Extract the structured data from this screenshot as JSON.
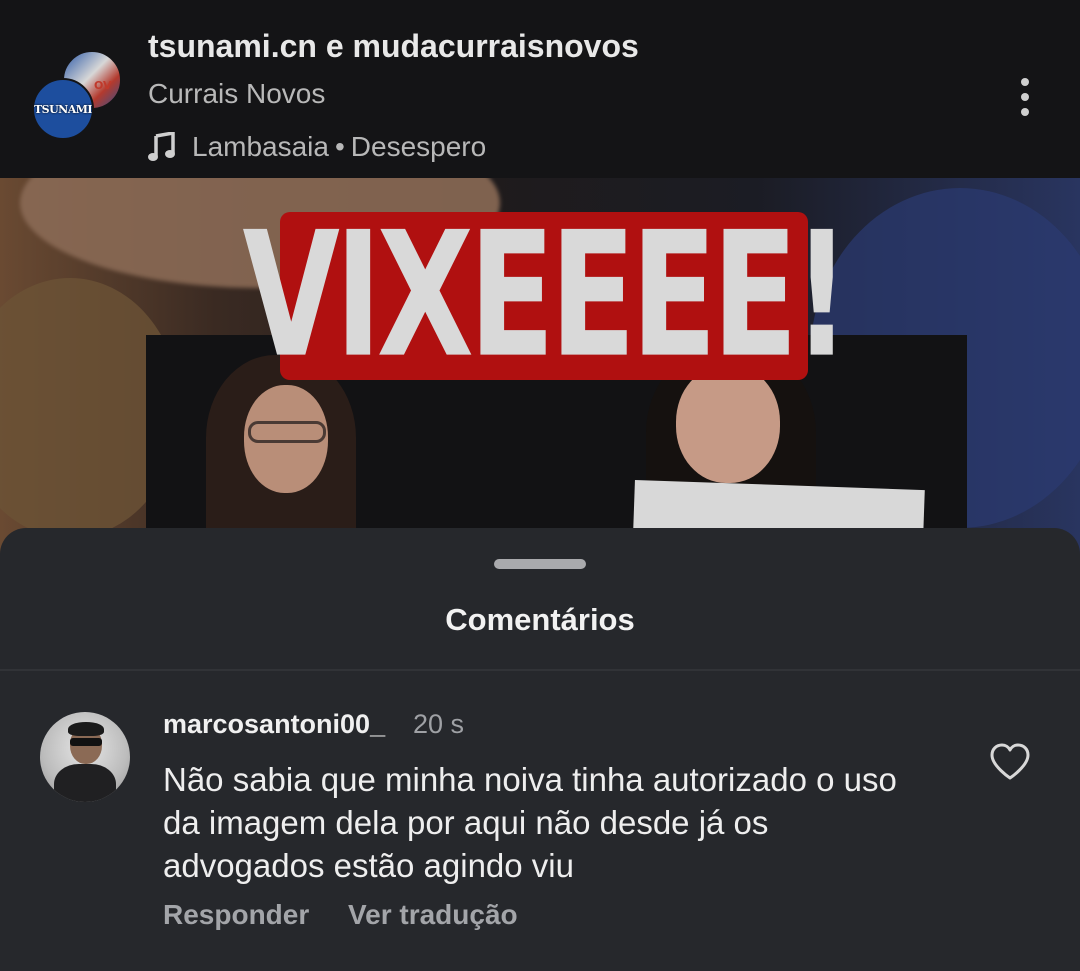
{
  "header": {
    "account_line": "tsunami.cn e mudacurraisnovos",
    "location": "Currais Novos",
    "music": {
      "artist": "Lambasaia",
      "separator": "•",
      "track": "Desespero"
    },
    "avatar_front_text": "TSUNAMI",
    "avatar_back_text": "OV"
  },
  "video": {
    "overlay_text": "VIXEEEE!"
  },
  "comments_sheet": {
    "title": "Comentários",
    "comments": [
      {
        "username": "marcosantoni00_",
        "time": "20 s",
        "text": "Não sabia que minha noiva tinha autorizado o uso da imagem dela por aqui não desde já os advogados estão agindo viu",
        "actions": {
          "reply": "Responder",
          "translate": "Ver tradução"
        }
      }
    ]
  },
  "icons": {
    "more": "more-vertical-icon",
    "music": "music-note-icon",
    "like": "heart-outline-icon"
  },
  "colors": {
    "header_bg": "#141416",
    "sheet_bg": "#26282c",
    "vix_red": "#b01010",
    "muted_text": "#9fa1a5"
  }
}
